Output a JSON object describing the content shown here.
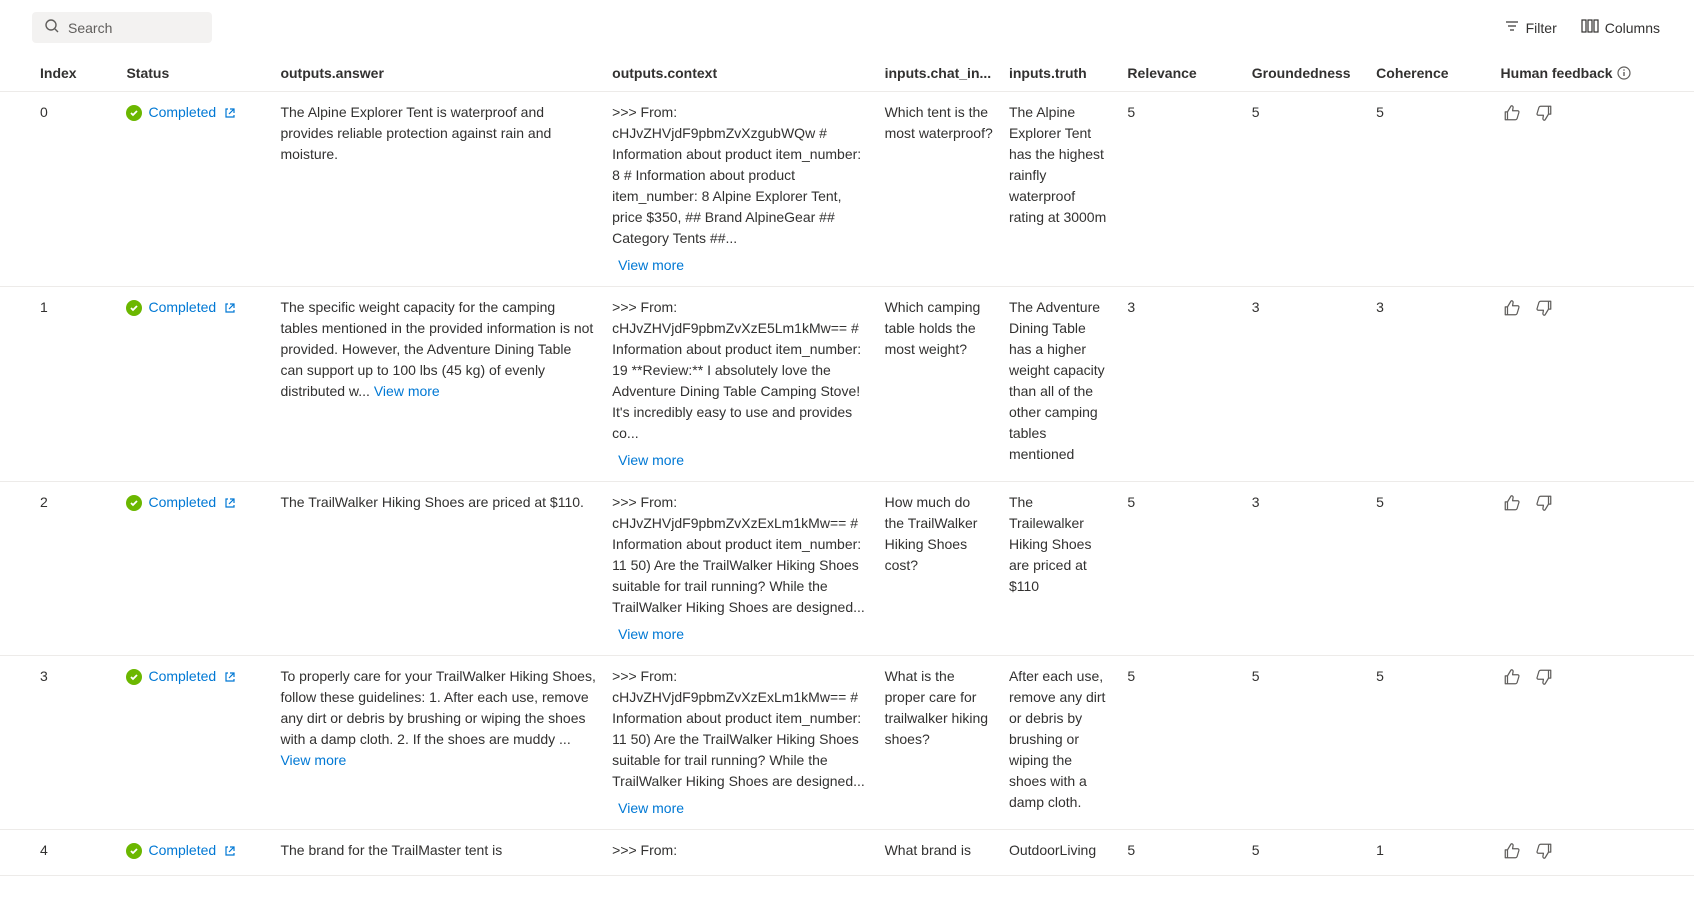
{
  "toolbar": {
    "search_placeholder": "Search",
    "filter_label": "Filter",
    "columns_label": "Columns"
  },
  "headers": {
    "index": "Index",
    "status": "Status",
    "answer": "outputs.answer",
    "context": "outputs.context",
    "chat_in": "inputs.chat_in...",
    "truth": "inputs.truth",
    "relevance": "Relevance",
    "groundedness": "Groundedness",
    "coherence": "Coherence",
    "feedback": "Human feedback"
  },
  "labels": {
    "completed": "Completed",
    "view_more": "View more"
  },
  "rows": [
    {
      "index": "0",
      "answer": "The Alpine Explorer Tent is waterproof and provides reliable protection against rain and moisture.",
      "answer_view_more": false,
      "context": ">>> From: cHJvZHVjdF9pbmZvXzgubWQw # Information about product item_number: 8 # Information about product item_number: 8 Alpine Explorer Tent, price $350, ## Brand AlpineGear ## Category Tents ##...",
      "chat_in": "Which tent is the most waterproof?",
      "truth": "The Alpine Explorer Tent has the highest rainfly waterproof rating at 3000m",
      "relevance": "5",
      "groundedness": "5",
      "coherence": "5"
    },
    {
      "index": "1",
      "answer": "The specific weight capacity for the camping tables mentioned in the provided information is not provided. However, the Adventure Dining Table can support up to 100 lbs (45 kg) of evenly distributed w... ",
      "answer_view_more": true,
      "context": ">>> From: cHJvZHVjdF9pbmZvXzE5Lm1kMw== # Information about product item_number: 19 **Review:** I absolutely love the Adventure Dining Table Camping Stove! It's incredibly easy to use and provides co...",
      "chat_in": "Which camping table holds the most weight?",
      "truth": "The Adventure Dining Table has a higher weight capacity than all of the other camping tables mentioned",
      "relevance": "3",
      "groundedness": "3",
      "coherence": "3"
    },
    {
      "index": "2",
      "answer": "The TrailWalker Hiking Shoes are priced at $110.",
      "answer_view_more": false,
      "context": ">>> From: cHJvZHVjdF9pbmZvXzExLm1kMw== # Information about product item_number: 11 50) Are the TrailWalker Hiking Shoes suitable for trail running? While the TrailWalker Hiking Shoes are designed...",
      "chat_in": "How much do the TrailWalker Hiking Shoes cost?",
      "truth": "The Trailewalker Hiking Shoes are priced at $110",
      "relevance": "5",
      "groundedness": "3",
      "coherence": "5"
    },
    {
      "index": "3",
      "answer": "To properly care for your TrailWalker Hiking Shoes, follow these guidelines: 1. After each use, remove any dirt or debris by brushing or wiping the shoes with a damp cloth. 2. If the shoes are muddy ... ",
      "answer_view_more": true,
      "context": ">>> From: cHJvZHVjdF9pbmZvXzExLm1kMw== # Information about product item_number: 11 50) Are the TrailWalker Hiking Shoes suitable for trail running? While the TrailWalker Hiking Shoes are designed...",
      "chat_in": "What is the proper care for trailwalker hiking shoes?",
      "truth": "After each use, remove any dirt or debris by brushing or wiping the shoes with a damp cloth.",
      "relevance": "5",
      "groundedness": "5",
      "coherence": "5"
    },
    {
      "index": "4",
      "answer": "The brand for the TrailMaster tent is",
      "answer_view_more": false,
      "context": ">>> From:",
      "context_view_more_hidden": true,
      "chat_in": "What brand is",
      "truth": "OutdoorLiving",
      "relevance": "5",
      "groundedness": "5",
      "coherence": "1"
    }
  ]
}
